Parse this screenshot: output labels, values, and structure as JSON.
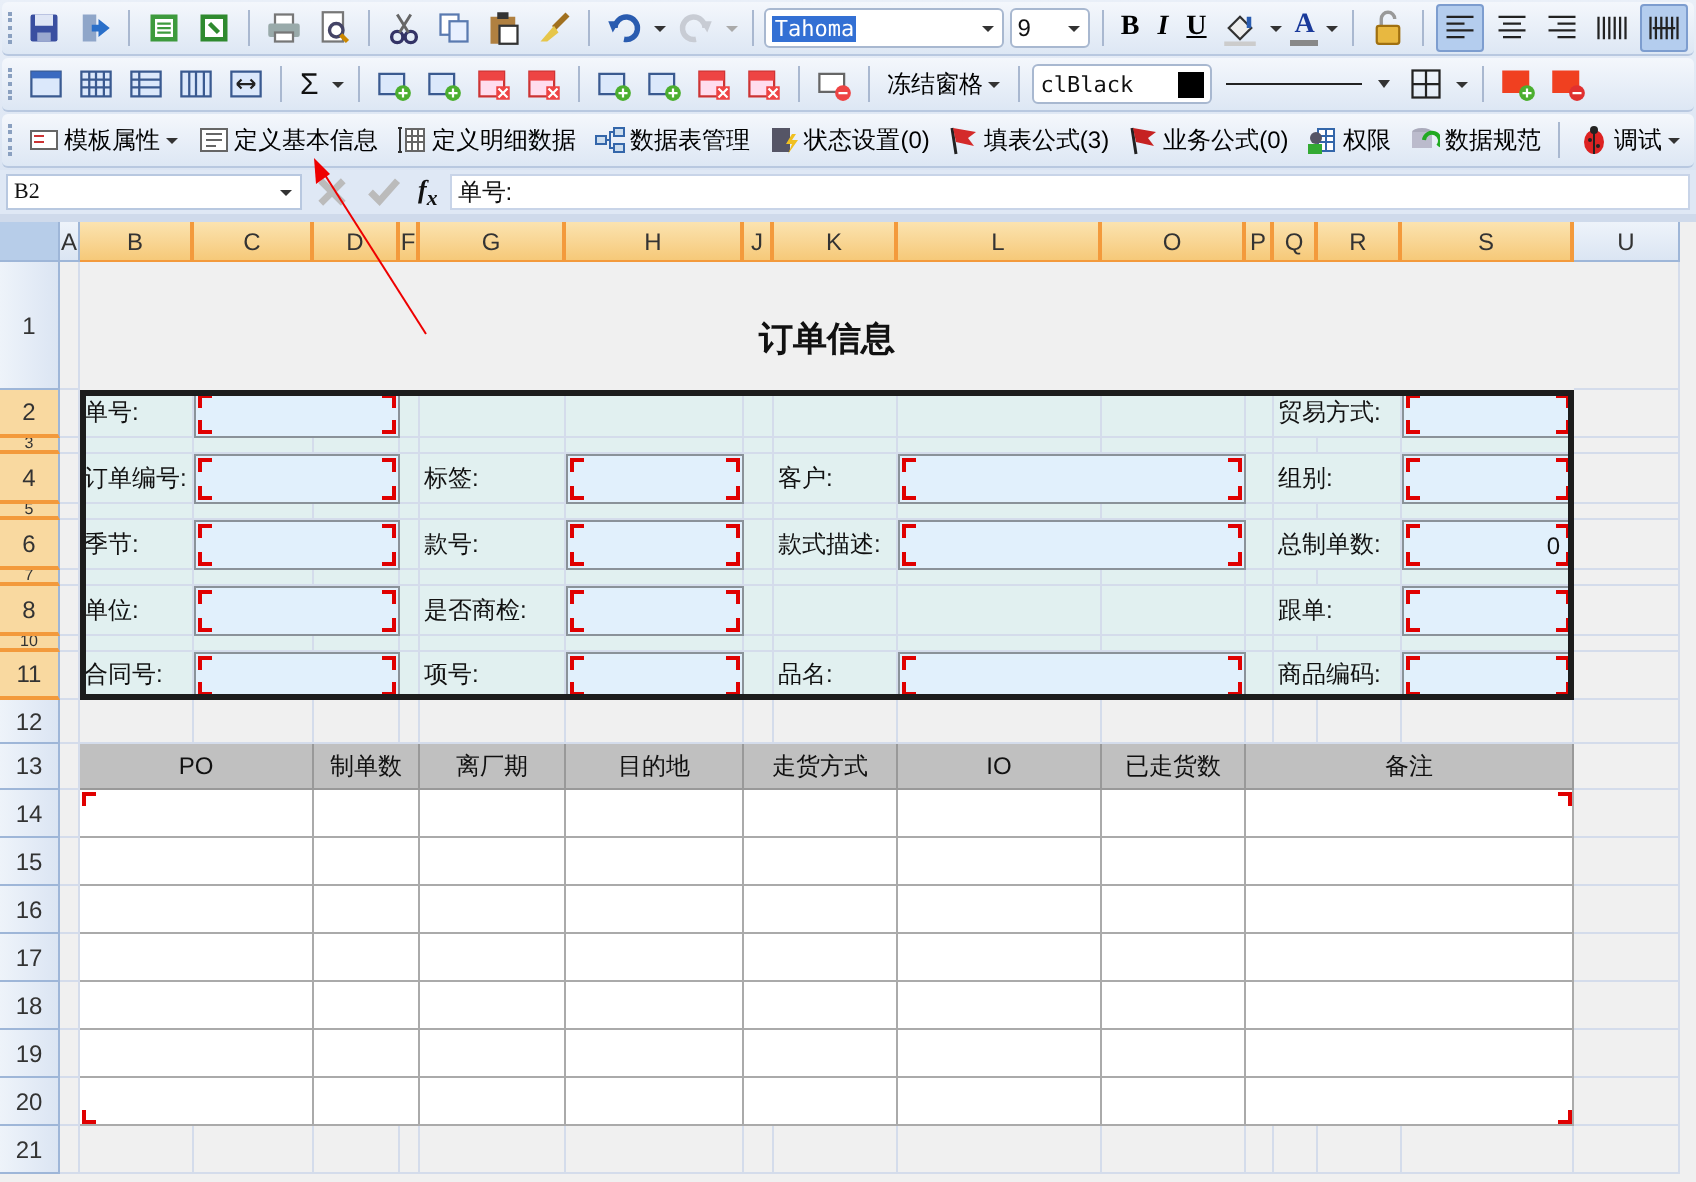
{
  "toolbar_1": {
    "font_name": "Tahoma",
    "font_size": "9",
    "format_buttons": [
      "B",
      "I",
      "U"
    ],
    "font_color_glyph": "A",
    "align_buttons": [
      {
        "selected": true
      },
      {
        "selected": false
      },
      {
        "selected": false
      },
      {
        "selected": false
      },
      {
        "selected": true
      }
    ]
  },
  "toolbar_2": {
    "sum_symbol": "Σ",
    "freeze_button": "冻结窗格",
    "color_field": "clBlack"
  },
  "toolbar_3": {
    "buttons": [
      {
        "label": "模板属性",
        "dropdown": true
      },
      {
        "label": "定义基本信息",
        "dropdown": false
      },
      {
        "label": "定义明细数据",
        "dropdown": false
      },
      {
        "label": "数据表管理",
        "dropdown": false
      },
      {
        "label": "状态设置(0)",
        "dropdown": false
      },
      {
        "label": "填表公式(3)",
        "dropdown": false
      },
      {
        "label": "业务公式(0)",
        "dropdown": false
      },
      {
        "label": "权限",
        "dropdown": false
      },
      {
        "label": "数据规范",
        "dropdown": false
      },
      {
        "label": "调试",
        "dropdown": true
      }
    ]
  },
  "formula_bar": {
    "cell_ref": "B2",
    "fx": "f$_{x}$",
    "formula": "单号:"
  },
  "sheet": {
    "columns": [
      {
        "label": "A",
        "selected": false
      },
      {
        "label": "B",
        "selected": true
      },
      {
        "label": "C",
        "selected": true
      },
      {
        "label": "D",
        "selected": true
      },
      {
        "label": "F",
        "selected": true
      },
      {
        "label": "G",
        "selected": true
      },
      {
        "label": "H",
        "selected": true
      },
      {
        "label": "J",
        "selected": true
      },
      {
        "label": "K",
        "selected": true
      },
      {
        "label": "L",
        "selected": true
      },
      {
        "label": "O",
        "selected": true
      },
      {
        "label": "P",
        "selected": true
      },
      {
        "label": "Q",
        "selected": true
      },
      {
        "label": "R",
        "selected": true
      },
      {
        "label": "S",
        "selected": true
      },
      {
        "label": "U",
        "selected": false
      }
    ],
    "rows": [
      {
        "label": "1",
        "selected": false
      },
      {
        "label": "2",
        "selected": true
      },
      {
        "label": "3",
        "selected": true
      },
      {
        "label": "4",
        "selected": true
      },
      {
        "label": "5",
        "selected": true
      },
      {
        "label": "6",
        "selected": true
      },
      {
        "label": "7",
        "selected": true
      },
      {
        "label": "8",
        "selected": true
      },
      {
        "label": "10",
        "selected": true
      },
      {
        "label": "11",
        "selected": true
      },
      {
        "label": "12",
        "selected": false
      },
      {
        "label": "13",
        "selected": false
      },
      {
        "label": "14",
        "selected": false
      },
      {
        "label": "15",
        "selected": false
      },
      {
        "label": "16",
        "selected": false
      },
      {
        "label": "17",
        "selected": false
      },
      {
        "label": "18",
        "selected": false
      },
      {
        "label": "19",
        "selected": false
      },
      {
        "label": "20",
        "selected": false
      },
      {
        "label": "21",
        "selected": false
      }
    ],
    "title": "订单信息",
    "form": [
      {
        "slots": [
          {
            "kind": "field",
            "label": "单号:"
          },
          {
            "kind": "empty"
          },
          {
            "kind": "empty"
          },
          {
            "kind": "field",
            "label": "贸易方式:"
          }
        ]
      },
      {
        "slots": [
          {
            "kind": "field",
            "label": "订单编号:"
          },
          {
            "kind": "field",
            "label": "标签:"
          },
          {
            "kind": "field",
            "label": "客户:"
          },
          {
            "kind": "field",
            "label": "组别:"
          }
        ]
      },
      {
        "slots": [
          {
            "kind": "field",
            "label": "季节:"
          },
          {
            "kind": "field",
            "label": "款号:"
          },
          {
            "kind": "field",
            "label": "款式描述:"
          },
          {
            "kind": "field",
            "label": "总制单数:",
            "value": "0"
          }
        ]
      },
      {
        "slots": [
          {
            "kind": "field",
            "label": "单位:"
          },
          {
            "kind": "field",
            "label": "是否商检:"
          },
          {
            "kind": "empty"
          },
          {
            "kind": "field",
            "label": "跟单:"
          }
        ]
      },
      {
        "slots": [
          {
            "kind": "field",
            "label": "合同号:"
          },
          {
            "kind": "field",
            "label": "项号:"
          },
          {
            "kind": "field",
            "label": "品名:"
          },
          {
            "kind": "field",
            "label": "商品编码:"
          }
        ]
      }
    ],
    "table": {
      "columns": [
        "PO",
        "制单数",
        "离厂期",
        "目的地",
        "走货方式",
        "IO",
        "已走货数",
        "备注"
      ]
    }
  }
}
